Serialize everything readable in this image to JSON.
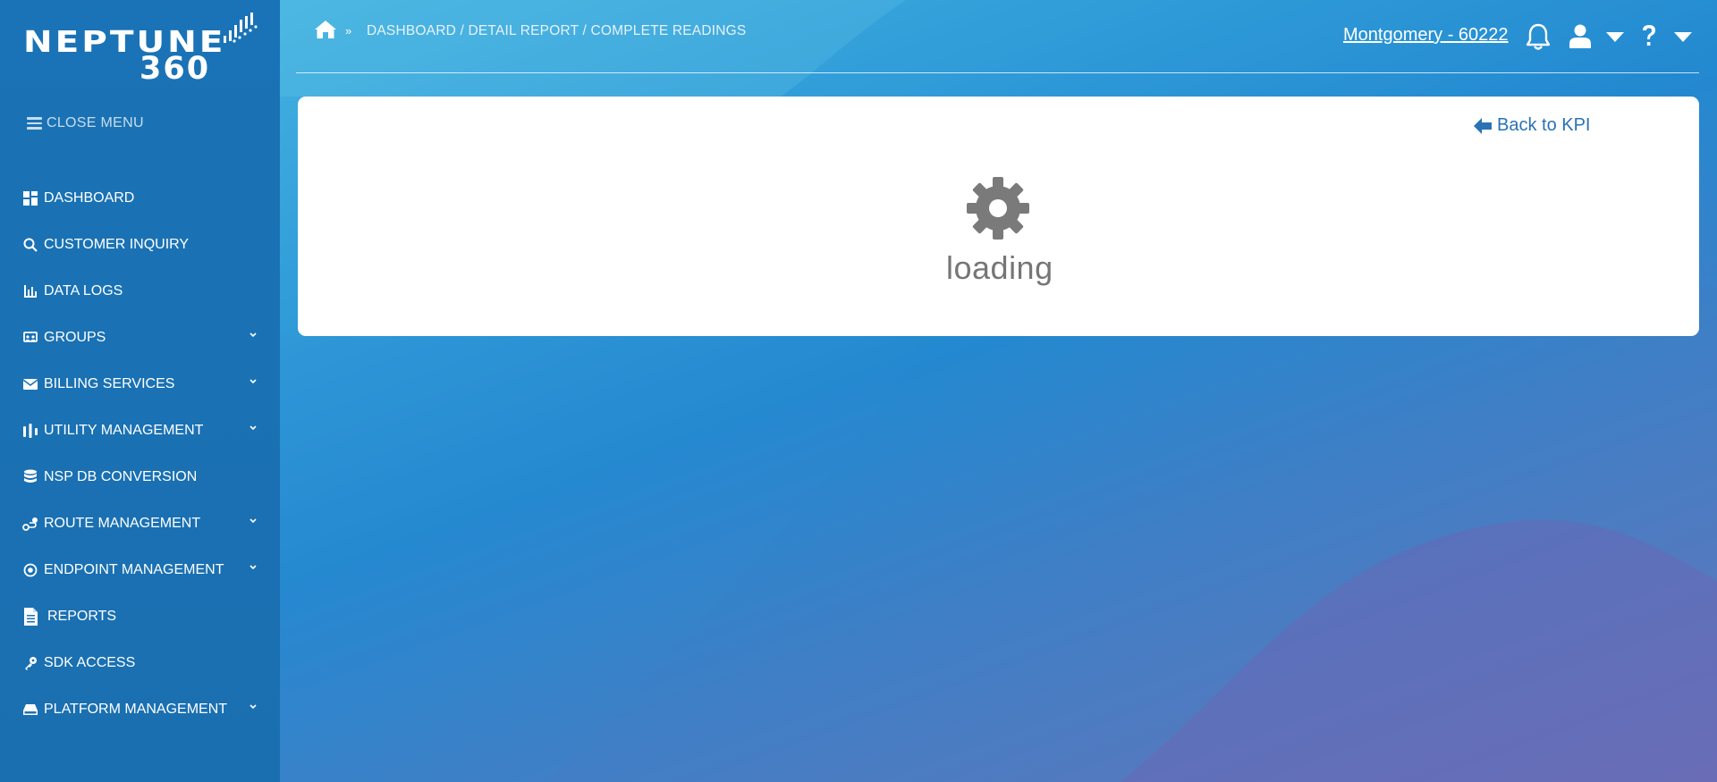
{
  "app": {
    "logo_name": "NEPTUNE",
    "logo_suffix": "360"
  },
  "sidebar": {
    "close_menu_label": "CLOSE MENU",
    "items": [
      {
        "label": "DASHBOARD",
        "icon": "grid-icon",
        "expandable": false
      },
      {
        "label": "CUSTOMER INQUIRY",
        "icon": "search-icon",
        "expandable": false
      },
      {
        "label": "DATA LOGS",
        "icon": "bar-chart-icon",
        "expandable": false
      },
      {
        "label": "GROUPS",
        "icon": "groups-icon",
        "expandable": true
      },
      {
        "label": "BILLING SERVICES",
        "icon": "envelope-icon",
        "expandable": true
      },
      {
        "label": "UTILITY MANAGEMENT",
        "icon": "signal-icon",
        "expandable": true
      },
      {
        "label": "NSP DB CONVERSION",
        "icon": "database-icon",
        "expandable": false
      },
      {
        "label": "ROUTE MANAGEMENT",
        "icon": "route-icon",
        "expandable": true
      },
      {
        "label": "ENDPOINT MANAGEMENT",
        "icon": "target-icon",
        "expandable": true
      },
      {
        "label": "REPORTS",
        "icon": "document-icon",
        "expandable": false
      },
      {
        "label": "SDK ACCESS",
        "icon": "key-icon",
        "expandable": false
      },
      {
        "label": "PLATFORM MANAGEMENT",
        "icon": "drive-icon",
        "expandable": true
      }
    ]
  },
  "header": {
    "breadcrumb": "DASHBOARD / DETAIL REPORT / COMPLETE READINGS",
    "location": "Montgomery - 60222"
  },
  "main": {
    "back_label": "Back to KPI",
    "loading_text": "loading"
  },
  "colors": {
    "sidebar_bg": "#1a73b6",
    "link": "#2a72b5",
    "loading_gray": "#767676"
  }
}
